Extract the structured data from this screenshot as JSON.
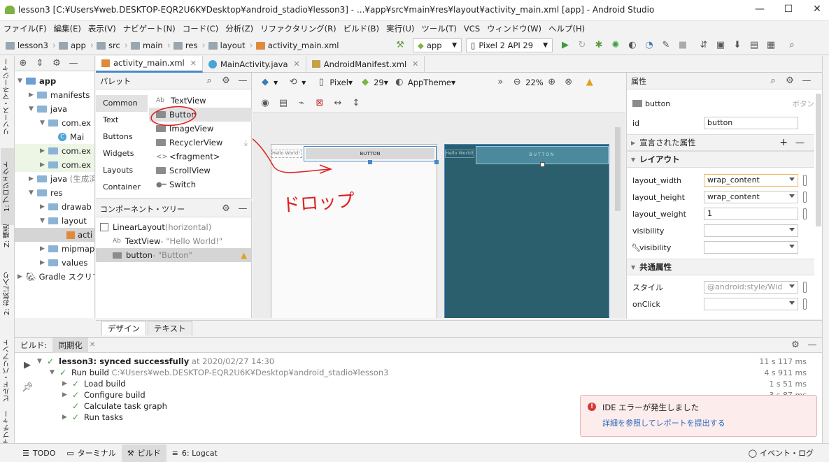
{
  "window": {
    "title": "lesson3 [C:¥Users¥web.DESKTOP-EQR2U6K¥Desktop¥android_stadio¥lesson3] - ...¥app¥src¥main¥res¥layout¥activity_main.xml [app] - Android Studio",
    "minimize": "—",
    "maximize": "☐",
    "close": "✕"
  },
  "menu": [
    "ファイル(F)",
    "編集(E)",
    "表示(V)",
    "ナビゲート(N)",
    "コード(C)",
    "分析(Z)",
    "リファクタリング(R)",
    "ビルド(B)",
    "実行(U)",
    "ツール(T)",
    "VCS",
    "ウィンドウ(W)",
    "ヘルプ(H)"
  ],
  "breadcrumbs": [
    "lesson3",
    "app",
    "src",
    "main",
    "res",
    "layout",
    "activity_main.xml"
  ],
  "toolbar": {
    "module": "app",
    "device": "Pixel 2 API 29"
  },
  "left_strip": {
    "resource_manager": "リソース・マネージャー",
    "project": "1: プロジェクト",
    "structure": "Z: 構造",
    "favorites": "2: お気に入り",
    "build_variants": "ビルド・バリアント",
    "capture": "ャプチャー"
  },
  "project_tree": [
    {
      "label": "app"
    },
    {
      "label": "manifests"
    },
    {
      "label": "java"
    },
    {
      "label": "com.ex"
    },
    {
      "label": "Mai"
    },
    {
      "label": "com.ex"
    },
    {
      "label": "com.ex"
    },
    {
      "label": "java",
      "suffix": "(生成済"
    },
    {
      "label": "res"
    },
    {
      "label": "drawab"
    },
    {
      "label": "layout"
    },
    {
      "label": "acti"
    },
    {
      "label": "mipmap"
    },
    {
      "label": "values"
    },
    {
      "label": "Gradle スクリプ"
    }
  ],
  "editor_tabs": [
    "activity_main.xml",
    "MainActivity.java",
    "AndroidManifest.xml"
  ],
  "palette": {
    "title": "パレット",
    "categories": [
      "Common",
      "Text",
      "Buttons",
      "Widgets",
      "Layouts",
      "Container"
    ],
    "items": [
      "TextView",
      "Button",
      "ImageView",
      "RecyclerView",
      "<fragment>",
      "ScrollView",
      "Switch"
    ]
  },
  "component_tree": {
    "title": "コンポーネント・ツリー",
    "root": "LinearLayout",
    "root_suffix": "(horizontal)",
    "children": [
      {
        "name": "TextView",
        "value": "- \"Hello World!\""
      },
      {
        "name": "button",
        "value": "- \"Button\""
      }
    ]
  },
  "design_toolbar": {
    "device": "Pixel",
    "api": "29",
    "theme": "AppTheme",
    "zoom": "22%"
  },
  "canvas": {
    "hello": "Hello World!",
    "button": "BUTTON",
    "annotation": "ドロップ"
  },
  "attributes": {
    "title": "属性",
    "widget": "button",
    "widget_type": "ボタン",
    "id_label": "id",
    "id_value": "button",
    "declared_section": "宣言された属性",
    "layout_section": "レイアウト",
    "rows": [
      {
        "label": "layout_width",
        "value": "wrap_content"
      },
      {
        "label": "layout_height",
        "value": "wrap_content"
      },
      {
        "label": "layout_weight",
        "value": "1"
      },
      {
        "label": "visibility",
        "value": ""
      },
      {
        "label": "visibility",
        "value": ""
      }
    ],
    "common_section": "共通属性",
    "style_label": "スタイル",
    "style_value": "@android:style/Wid",
    "onclick_label": "onClick"
  },
  "bottom_tabs": [
    "デザイン",
    "テキスト"
  ],
  "build": {
    "tabs": [
      "ビルド:",
      "同期化"
    ],
    "rows": [
      {
        "text": "lesson3: synced successfully",
        "extra": "at 2020/02/27 14:30",
        "time": "11 s 117 ms"
      },
      {
        "text": "Run build",
        "extra": "C:¥Users¥web.DESKTOP-EQR2U6K¥Desktop¥android_stadio¥lesson3",
        "time": "4 s 911 ms"
      },
      {
        "text": "Load build",
        "extra": "",
        "time": "1 s 51 ms"
      },
      {
        "text": "Configure build",
        "extra": "",
        "time": "3 s 87 ms"
      },
      {
        "text": "Calculate task graph",
        "extra": "",
        "time": ""
      },
      {
        "text": "Run tasks",
        "extra": "",
        "time": ""
      }
    ]
  },
  "error_popup": {
    "title": "IDE エラーが発生しました",
    "link": "詳細を参照してレポートを提出する"
  },
  "status_tabs": [
    "TODO",
    "ターミナル",
    "ビルド",
    "6: Logcat"
  ],
  "event_log": "イベント・ログ",
  "colors": {
    "accent": "#4a88c7",
    "blueprint": "#2b5f6e",
    "annotation": "#e02020",
    "success": "#3c9b3c",
    "error": "#d9373a"
  }
}
